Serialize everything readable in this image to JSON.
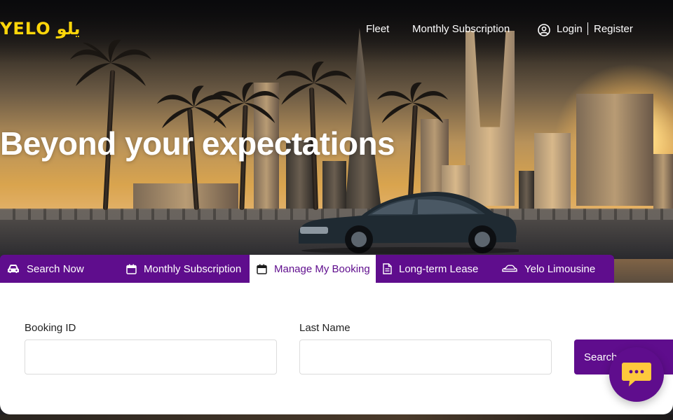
{
  "brand": {
    "logo_latin": "YELO",
    "logo_arabic": "يلو",
    "accent": "#ffd60a",
    "primary": "#5f0d8d"
  },
  "nav": {
    "fleet": "Fleet",
    "monthly_subscription": "Monthly Subscription",
    "login": "Login",
    "register": "Register",
    "user_icon": "user-circle-icon"
  },
  "hero": {
    "headline": "Beyond your expectations"
  },
  "tabs": [
    {
      "label": "Search Now",
      "icon": "car-icon",
      "active": false
    },
    {
      "label": "Monthly Subscription",
      "icon": "calendar-icon",
      "active": false
    },
    {
      "label": "Manage My Booking",
      "icon": "calendar-icon",
      "active": true
    },
    {
      "label": "Long-term Lease",
      "icon": "document-icon",
      "active": false
    },
    {
      "label": "Yelo Limousine",
      "icon": "limousine-icon",
      "active": false
    }
  ],
  "form": {
    "booking_id_label": "Booking ID",
    "booking_id_value": "",
    "last_name_label": "Last Name",
    "last_name_value": "",
    "search_label": "Search"
  },
  "chat": {
    "icon": "chat-bubble-icon"
  }
}
